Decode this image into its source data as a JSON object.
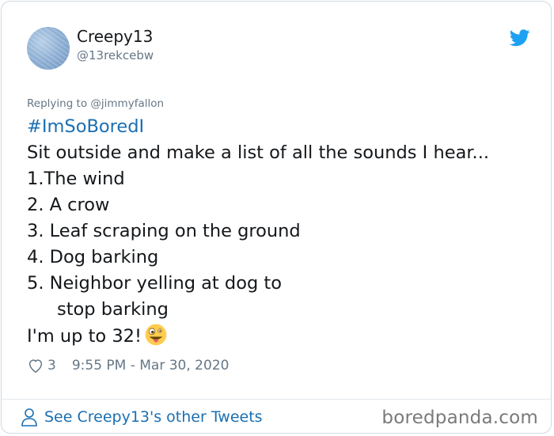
{
  "user": {
    "display_name": "Creepy13",
    "handle": "@13rekcebw"
  },
  "reply": {
    "text": "Replying to @jimmyfallon"
  },
  "tweet": {
    "hashtag": "#ImSoBoredI",
    "lines": [
      "Sit outside and make a list of all the sounds I hear...",
      "1.The wind",
      "2. A crow",
      "3. Leaf scraping on the ground",
      "4. Dog barking",
      "5. Neighbor yelling at dog to",
      "stop barking",
      "I'm up to 32!"
    ],
    "emoji": "zany-face"
  },
  "meta": {
    "likes": "3",
    "timestamp": "9:55 PM - Mar 30, 2020"
  },
  "footer": {
    "link_text": "See Creepy13's other Tweets",
    "watermark": "boredpanda.com"
  },
  "colors": {
    "link": "#1b6fb2",
    "muted": "#657786",
    "twitter_blue": "#1da1f2",
    "border": "#cfd9de"
  },
  "icons": [
    "twitter-bird-icon",
    "heart-icon",
    "person-icon",
    "zany-face-emoji"
  ]
}
